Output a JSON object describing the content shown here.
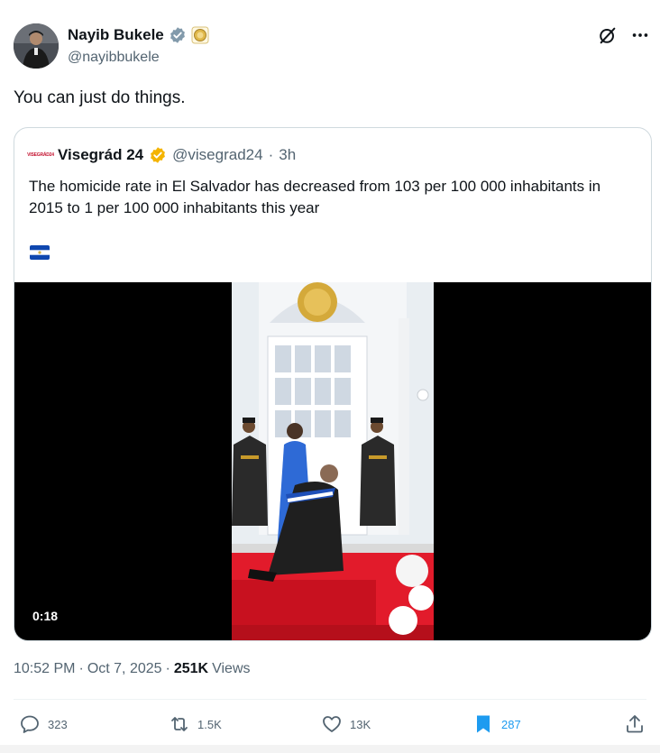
{
  "author": {
    "name": "Nayib Bukele",
    "handle": "@nayibbukele"
  },
  "post": {
    "text": "You can just do things."
  },
  "quoted": {
    "logo_text": "VISEGRÁD24",
    "name": "Visegrád 24",
    "handle": "@visegrad24",
    "separator": "·",
    "time": "3h",
    "text": "The homicide rate in El Salvador has decreased from 103 per 100 000 inhabitants in 2015 to 1 per 100 000 inhabitants this year",
    "flag": "El Salvador flag",
    "video": {
      "duration": "0:18"
    }
  },
  "timestamp": {
    "time": "10:52 PM",
    "sep1": "·",
    "date": "Oct 7, 2025",
    "sep2": "·",
    "views_count": "251K",
    "views_label": "Views"
  },
  "actions": {
    "replies": "323",
    "reposts": "1.5K",
    "likes": "13K",
    "bookmarks": "287"
  },
  "colors": {
    "text": "#0f1419",
    "secondary": "#536471",
    "accent": "#1d9bf0",
    "border": "#cfd9de",
    "gold_badge": "#f4b400"
  },
  "icons": [
    "verified-badge-icon",
    "gold-seal-icon",
    "grok-icon",
    "more-icon",
    "reply-icon",
    "repost-icon",
    "like-icon",
    "bookmark-icon",
    "share-icon"
  ]
}
